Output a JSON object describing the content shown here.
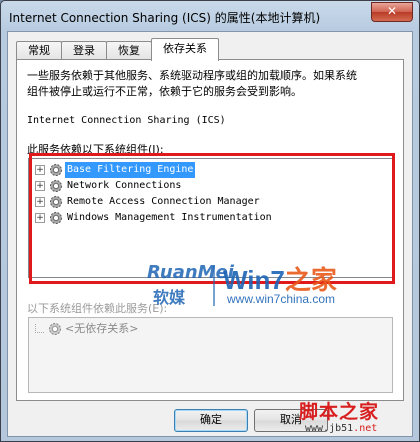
{
  "window": {
    "title": "Internet Connection Sharing (ICS) 的属性(本地计算机)",
    "close_glyph": "✕"
  },
  "tabs": [
    {
      "label": "常规"
    },
    {
      "label": "登录"
    },
    {
      "label": "恢复"
    },
    {
      "label": "依存关系"
    }
  ],
  "dependencies": {
    "description": "一些服务依赖于其他服务、系统驱动程序或组的加载顺序。如果系统\n组件被停止或运行不正常，依赖于它的服务会受到影响。",
    "service_name": "Internet Connection Sharing (ICS)",
    "depends_on_label": "此服务依赖以下系统组件(I):",
    "depends_on_items": [
      {
        "label": "Base Filtering Engine",
        "expander": "+",
        "icon": "gear-icon",
        "selected": true
      },
      {
        "label": "Network Connections",
        "expander": "+",
        "icon": "gear-icon",
        "selected": false
      },
      {
        "label": "Remote Access Connection Manager",
        "expander": "+",
        "icon": "gear-icon",
        "selected": false
      },
      {
        "label": "Windows Management Instrumentation",
        "expander": "+",
        "icon": "gear-icon",
        "selected": false
      }
    ],
    "dependents_label": "以下系统组件依赖此服务(E):",
    "dependents_items": [
      {
        "label": "<无依存关系>",
        "icon": "gear-icon"
      }
    ]
  },
  "buttons": {
    "ok": "确定",
    "cancel": "取消"
  },
  "watermark": {
    "brand_en": "RuanMei",
    "brand_cn": "软媒",
    "win7_a": "Win7",
    "win7_b": "之家",
    "win7_url": "www.win7china.com",
    "jb_cn": "脚本之家",
    "jb_url_a": "www.jb51",
    "jb_url_b": ".net"
  },
  "colors": {
    "highlight_border": "#e01a1a",
    "selection": "#3399ff",
    "watermark_blue": "#1e64b4",
    "watermark_red": "#d81e1e"
  }
}
